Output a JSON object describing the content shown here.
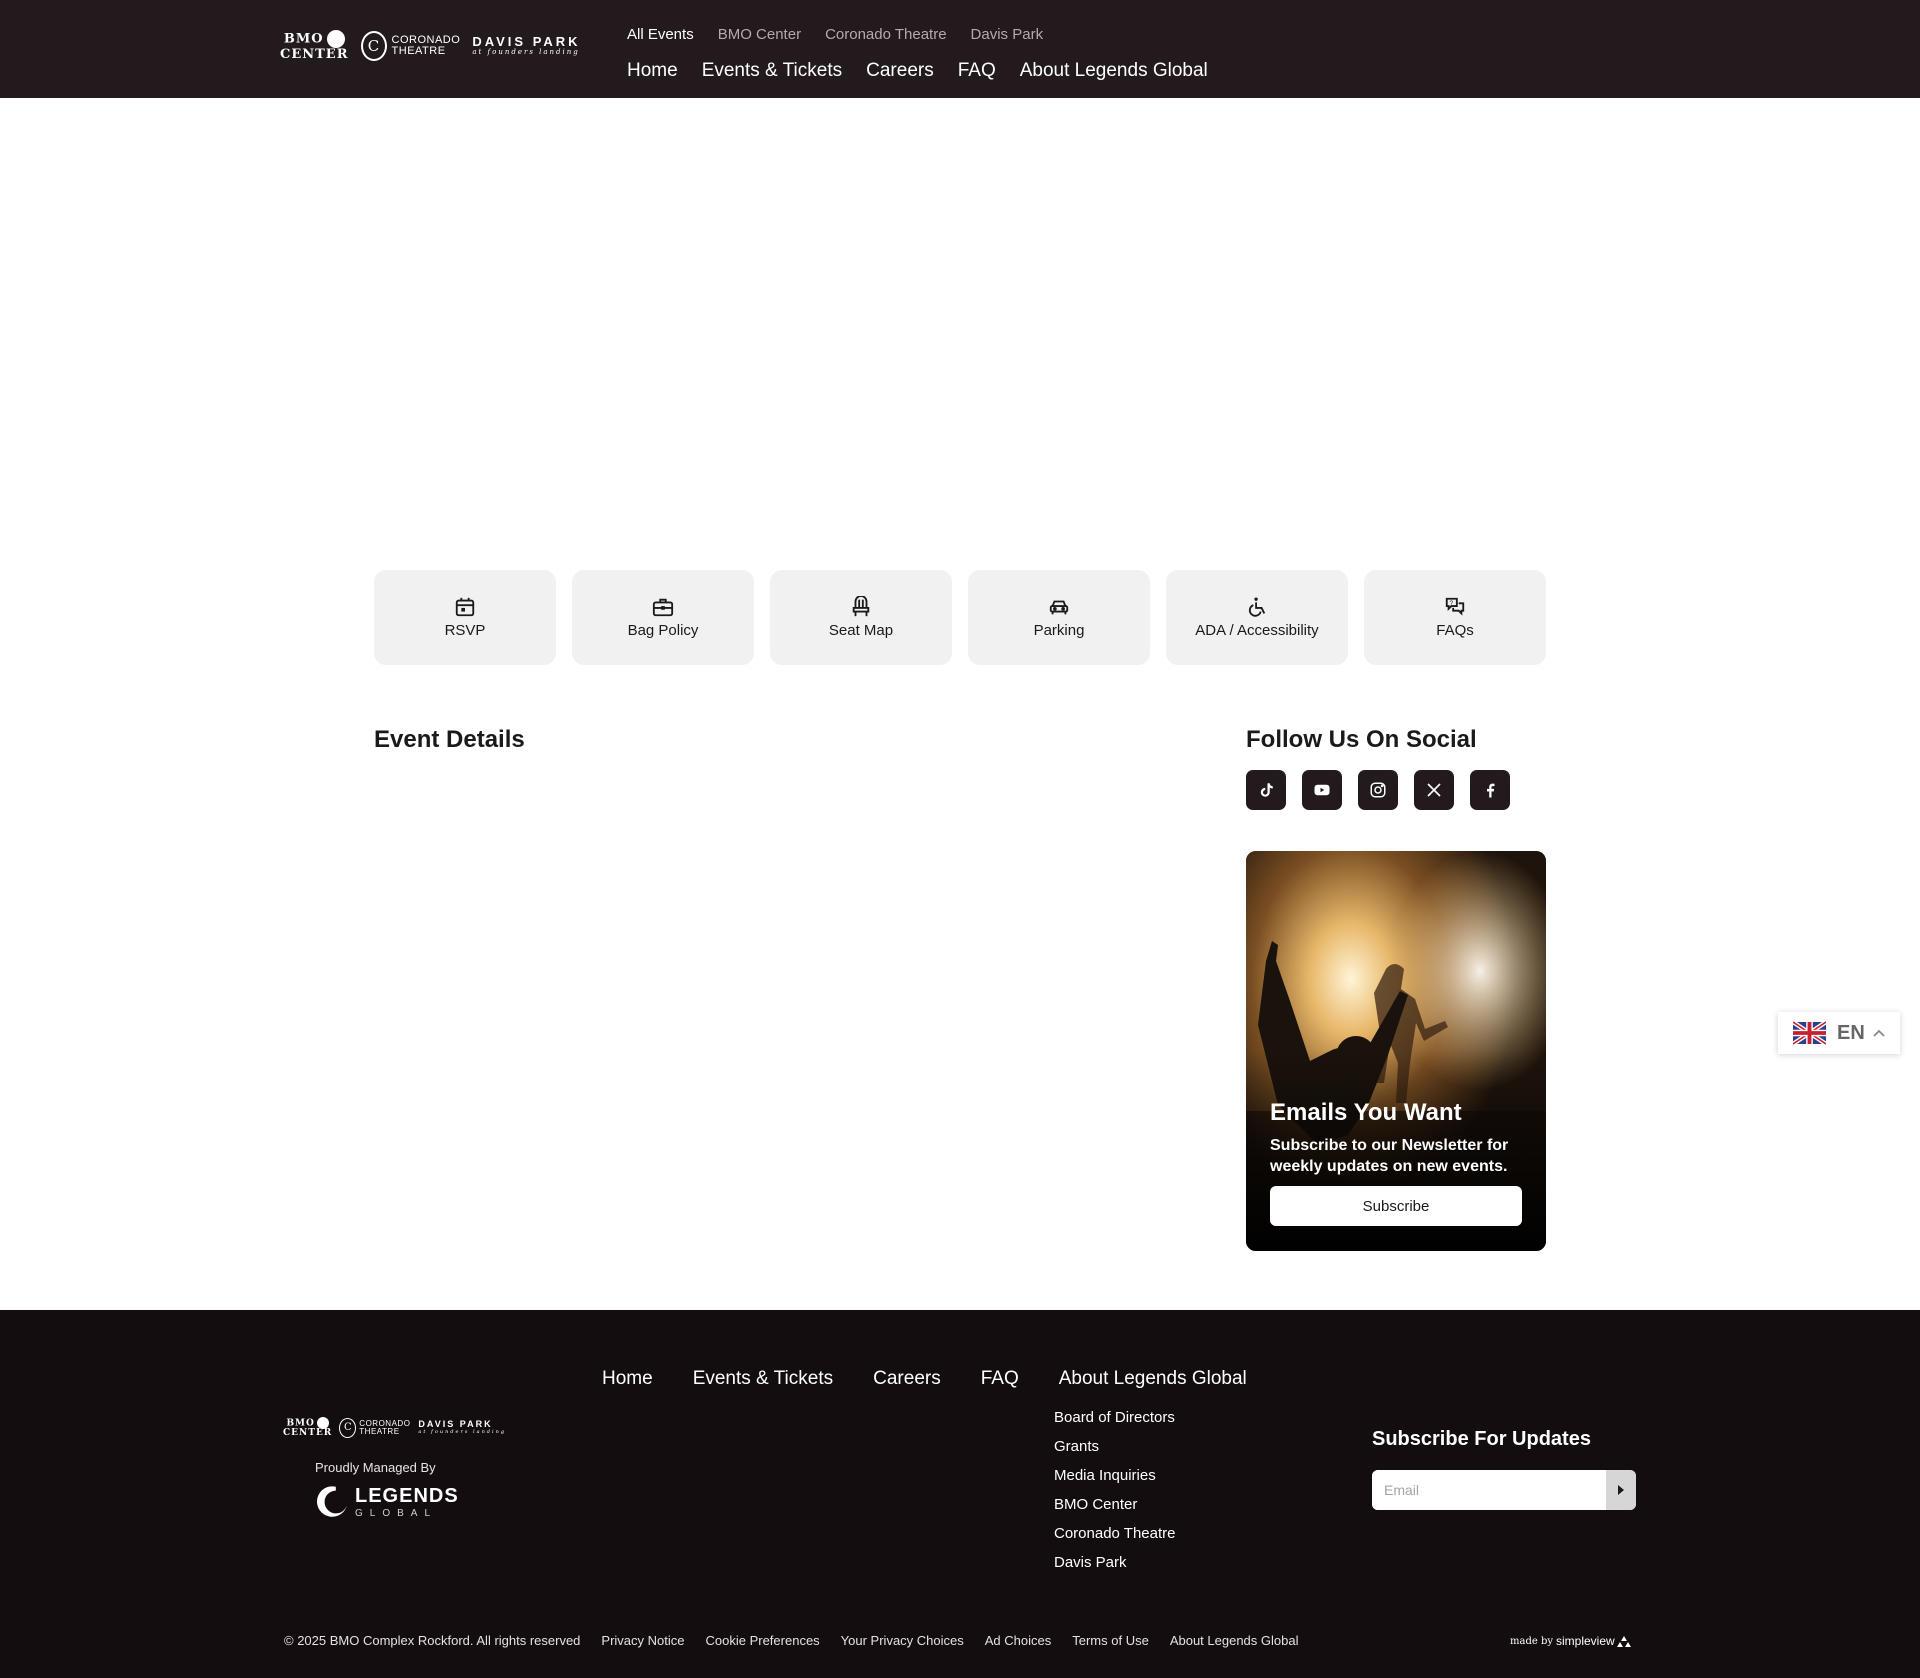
{
  "brand": {
    "bmo_line1": "BMO",
    "bmo_line2": "CENTER",
    "coronado_line1": "CORONADO",
    "coronado_line2": "THEATRE",
    "coronado_initial": "C",
    "davis_line1": "DAVIS PARK",
    "davis_line2": "at founders landing"
  },
  "header": {
    "subnav": [
      "All Events",
      "BMO Center",
      "Coronado Theatre",
      "Davis Park"
    ],
    "mainnav": [
      "Home",
      "Events & Tickets",
      "Careers",
      "FAQ",
      "About Legends Global"
    ]
  },
  "quick_links": [
    {
      "label": "RSVP",
      "icon": "calendar-icon"
    },
    {
      "label": "Bag Policy",
      "icon": "briefcase-icon"
    },
    {
      "label": "Seat Map",
      "icon": "seat-icon"
    },
    {
      "label": "Parking",
      "icon": "car-icon"
    },
    {
      "label": "ADA / Accessibility",
      "icon": "wheelchair-icon"
    },
    {
      "label": "FAQs",
      "icon": "chat-bubbles-icon"
    }
  ],
  "event": {
    "heading": "Event Details"
  },
  "social": {
    "heading": "Follow Us On Social",
    "icons": [
      "tiktok-icon",
      "youtube-icon",
      "instagram-icon",
      "x-icon",
      "facebook-icon"
    ]
  },
  "promo": {
    "title": "Emails You Want",
    "text": "Subscribe to our Newsletter for weekly updates on new events.",
    "button": "Subscribe"
  },
  "language": {
    "code": "EN"
  },
  "footer": {
    "nav": [
      "Home",
      "Events & Tickets",
      "Careers",
      "FAQ",
      "About Legends Global"
    ],
    "about_links": [
      "Board of Directors",
      "Grants",
      "Media Inquiries",
      "BMO Center",
      "Coronado Theatre",
      "Davis Park"
    ],
    "managed_by": "Proudly Managed By",
    "legends_line1": "LEGENDS",
    "legends_line2": "GLOBAL",
    "subscribe_title": "Subscribe For Updates",
    "email_placeholder": "Email",
    "copyright": "© 2025 BMO Complex Rockford. All rights reserved",
    "legal_links": [
      "Privacy Notice",
      "Cookie Preferences",
      "Your Privacy Choices",
      "Ad Choices",
      "Terms of Use",
      "About Legends Global"
    ],
    "made_by": "made by",
    "simpleview": "simpleview"
  },
  "colors": {
    "header_bg": "#231a1d",
    "footer_bg": "#140d10",
    "card_bg": "#f1f1f1",
    "social_bg": "#231a1d"
  }
}
